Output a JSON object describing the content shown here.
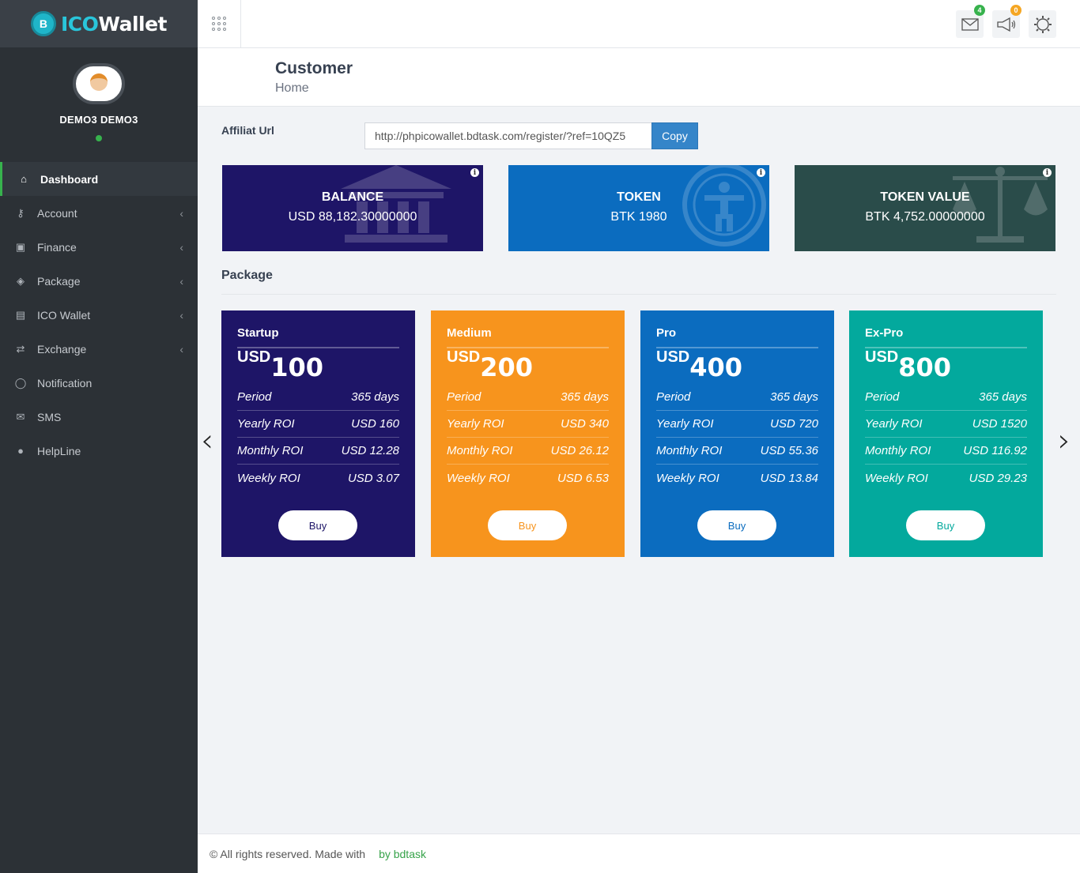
{
  "brand": {
    "logo_ico": "ICO",
    "logo_wallet": "Wallet",
    "coin_letter": "B"
  },
  "user": {
    "name": "DEMO3 DEMO3",
    "status_color": "#37b24d"
  },
  "sidebar": {
    "items": [
      {
        "label": "Dashboard",
        "icon": "home-icon",
        "active": true
      },
      {
        "label": "Account",
        "icon": "key-icon",
        "chevron": true
      },
      {
        "label": "Finance",
        "icon": "money-icon",
        "chevron": true
      },
      {
        "label": "Package",
        "icon": "box-icon",
        "chevron": true
      },
      {
        "label": "ICO Wallet",
        "icon": "id-card-icon",
        "chevron": true
      },
      {
        "label": "Exchange",
        "icon": "exchange-icon",
        "chevron": true
      },
      {
        "label": "Notification",
        "icon": "comment-icon"
      },
      {
        "label": "SMS",
        "icon": "envelope-icon"
      },
      {
        "label": "HelpLine",
        "icon": "chat-icon"
      }
    ]
  },
  "topbar": {
    "mail_badge": "4",
    "announce_badge": "0",
    "mail_badge_color": "#37b24d",
    "announce_badge_color": "#f5a623"
  },
  "header": {
    "title": "Customer",
    "subtitle": "Home"
  },
  "affiliate": {
    "label": "Affiliat Url",
    "url": "http://phpicowallet.bdtask.com/register/?ref=10QZ5",
    "copy_label": "Copy"
  },
  "stats": [
    {
      "title": "BALANCE",
      "value": "USD 88,182.30000000",
      "color": "#1e1567",
      "icon": "bank-icon"
    },
    {
      "title": "TOKEN",
      "value": "BTK 1980",
      "color": "#0b6cbf",
      "icon": "accessibility-icon"
    },
    {
      "title": "TOKEN VALUE",
      "value": "BTK 4,752.00000000",
      "color": "#2a4c4a",
      "icon": "balance-scale-icon"
    }
  ],
  "package_heading": "Package",
  "packages": [
    {
      "name": "Startup",
      "currency": "USD",
      "amount": "100",
      "color": "#1e1567",
      "btn_color": "#1e1567",
      "rows": [
        [
          "Period",
          "365 days"
        ],
        [
          "Yearly ROI",
          "USD 160"
        ],
        [
          "Monthly ROI",
          "USD 12.28"
        ],
        [
          "Weekly ROI",
          "USD 3.07"
        ]
      ],
      "buy": "Buy"
    },
    {
      "name": "Medium",
      "currency": "USD",
      "amount": "200",
      "color": "#f7941d",
      "btn_color": "#f7941d",
      "rows": [
        [
          "Period",
          "365 days"
        ],
        [
          "Yearly ROI",
          "USD 340"
        ],
        [
          "Monthly ROI",
          "USD 26.12"
        ],
        [
          "Weekly ROI",
          "USD 6.53"
        ]
      ],
      "buy": "Buy"
    },
    {
      "name": "Pro",
      "currency": "USD",
      "amount": "400",
      "color": "#0b6cbf",
      "btn_color": "#0b6cbf",
      "rows": [
        [
          "Period",
          "365 days"
        ],
        [
          "Yearly ROI",
          "USD 720"
        ],
        [
          "Monthly ROI",
          "USD 55.36"
        ],
        [
          "Weekly ROI",
          "USD 13.84"
        ]
      ],
      "buy": "Buy"
    },
    {
      "name": "Ex-Pro",
      "currency": "USD",
      "amount": "800",
      "color": "#03a99d",
      "btn_color": "#03a99d",
      "rows": [
        [
          "Period",
          "365 days"
        ],
        [
          "Yearly ROI",
          "USD 1520"
        ],
        [
          "Monthly ROI",
          "USD 116.92"
        ],
        [
          "Weekly ROI",
          "USD 29.23"
        ]
      ],
      "buy": "Buy"
    }
  ],
  "footer": {
    "text": "© All rights reserved. Made with",
    "heart": "",
    "brand": "by bdtask"
  }
}
